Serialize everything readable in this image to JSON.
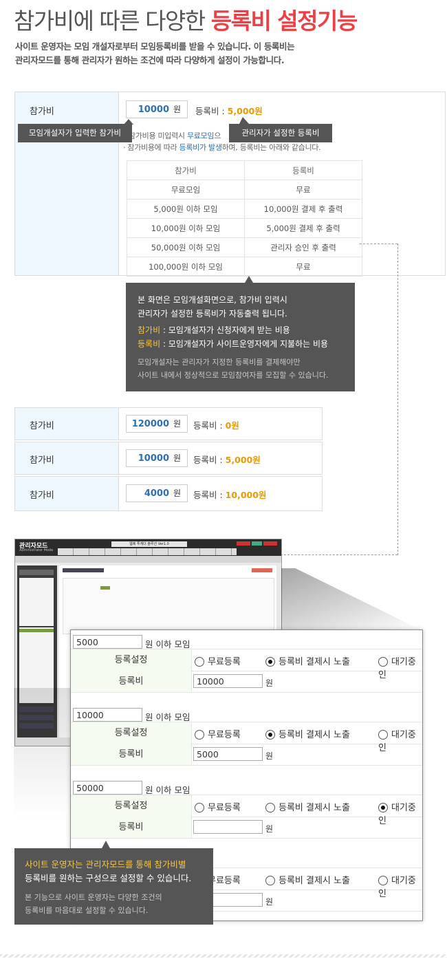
{
  "header": {
    "title_main": "참가비에 따른 다양한",
    "title_highlight": "등록비 설정기능",
    "intro_line1": "사이트 운영자는 모임 개설자로부터 모임등록비를 받을 수 있습니다. 이 등록비는",
    "intro_line2": "관리자모드를 통해 관리자가 원하는 조건에 따라 다양하게 설정이 가능합니다."
  },
  "main_form": {
    "label": "참가비",
    "value": "10000",
    "unit": "원",
    "fee_label": "등록비 :",
    "fee_value": "5,000원",
    "tip_left": "모임개설자가 입력한 참가비",
    "tip_right": "관리자가 설정한 등록비",
    "note1_pre": "참가비용 미입력시",
    "note1_link": "무료모임",
    "note1_post": "으",
    "note2_pre": "· 참가비용에 따라",
    "note2_link": "등록비가 발생",
    "note2_post": "하며, 등록비는 아래와 같습니다.",
    "table": {
      "headers": [
        "참가비",
        "등록비"
      ],
      "rows": [
        [
          "무료모임",
          "무료"
        ],
        [
          "5,000원 이하 모임",
          "10,000원 결제 후 출력"
        ],
        [
          "10,000원 이하 모임",
          "5,000원 결제 후 출력"
        ],
        [
          "50,000원 이하 모임",
          "관리자 승인 후 출력"
        ],
        [
          "100,000원 이하 모임",
          "무료"
        ]
      ]
    }
  },
  "info_box": {
    "line1": "본 화면은 모임개설화면으로, 참가비 입력시",
    "line2": "관리자가 설정한 등록비가 자동출력 됩니다.",
    "def1_term": "참가비",
    "def1_text": " : 모임개설자가 신청자에게 받는 비용",
    "def2_term": "등록비",
    "def2_text": " : 모임개설자가 사이트운영자에게 지불하는 비용",
    "note1": "모임개설자는 관리자가 지정한 등록비를 결제해야만",
    "note2": "사이트 내에서 정상적으로 모임참여자를 모집할 수 있습니다."
  },
  "examples": [
    {
      "label": "참가비",
      "value": "120000",
      "unit": "원",
      "fee_label": "등록비 :",
      "fee_value": "0원"
    },
    {
      "label": "참가비",
      "value": "10000",
      "unit": "원",
      "fee_label": "등록비 :",
      "fee_value": "5,000원"
    },
    {
      "label": "참가비",
      "value": "4000",
      "unit": "원",
      "fee_label": "등록비 :",
      "fee_value": "10,000원"
    }
  ],
  "admin_screen": {
    "logo": "관리자모드",
    "logo_sub": "Administrator Mode",
    "top_title": "웹제 투게더 솔루션 Ver1.0"
  },
  "panel": {
    "groups": [
      {
        "threshold": "5000",
        "suffix": "원 이하 모임",
        "setting_label": "등록설정",
        "opt1": "무료등록",
        "opt2": "등록비 결제시 노출",
        "opt3": "대기중인",
        "selected": 2,
        "fee_label": "등록비",
        "fee_value": "10000",
        "fee_unit": "원"
      },
      {
        "threshold": "10000",
        "suffix": "원 이하 모임",
        "setting_label": "등록설정",
        "opt1": "무료등록",
        "opt2": "등록비 결제시 노출",
        "opt3": "대기중인",
        "selected": 2,
        "fee_label": "등록비",
        "fee_value": "5000",
        "fee_unit": "원"
      },
      {
        "threshold": "50000",
        "suffix": "원 이하 모임",
        "setting_label": "등록설정",
        "opt1": "무료등록",
        "opt2": "등록비 결제시 노출",
        "opt3": "대기중인",
        "selected": 3,
        "fee_label": "등록비",
        "fee_value": "",
        "fee_unit": "원"
      },
      {
        "threshold": "",
        "suffix": "",
        "setting_label": "",
        "opt1": "무료등록",
        "opt2": "등록비 결제시 노출",
        "opt3": "대기중인",
        "selected": 0,
        "fee_label": "",
        "fee_value": "",
        "fee_unit": "원"
      }
    ]
  },
  "bottom_info": {
    "line1": "사이트 운영자는 관리자모드를 통해 참가비별",
    "line2": "등록비를 원하는 구성으로 설정할 수 있습니다.",
    "note1": "본 기능으로 사이트 운영자는 다양한 조건의",
    "note2": "등록비를 마음대로 설정할 수 있습니다."
  },
  "colors": {
    "accent": "#ec3f46",
    "fee": "#e89a00",
    "link": "#2d6fb5",
    "dark_box": "#555555",
    "label_bg": "#eef7fd"
  }
}
